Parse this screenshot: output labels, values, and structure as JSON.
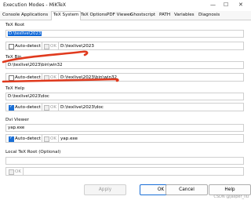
{
  "window": {
    "title": "Execution Modes - MiKTeX"
  },
  "tabs": [
    "Console Applications",
    "TeX System",
    "TeX Options",
    "PDF Viewer",
    "Ghostscript",
    "PATH",
    "Variables",
    "Diagnosis"
  ],
  "active_tab": "TeX System",
  "sections": {
    "tex_root": {
      "label": "TeX Root",
      "path": "D:\\texlive\\2023",
      "auto_detect": "Auto-detect",
      "ok": "OK",
      "detected": "D:\\texlive\\2023"
    },
    "tex_bin": {
      "label": "TeX Bin",
      "path": "D:\\texlive\\2023\\bin\\win32",
      "auto_detect": "Auto-detect",
      "ok": "OK",
      "detected": "D:\\texlive\\2023\\bin\\win32"
    },
    "tex_help": {
      "label": "TeX Help",
      "path": "D:\\texlive\\2023\\doc",
      "auto_detect": "Auto-detect",
      "ok": "OK",
      "detected": "D:\\texlive\\2023\\doc"
    },
    "dvi_viewer": {
      "label": "Dvi Viewer",
      "path": "yap.exe",
      "auto_detect": "Auto-detect",
      "ok": "OK",
      "detected": "yap.exe"
    },
    "local_tex_root": {
      "label": "Local TeX Root (Optional)",
      "path": "",
      "ok": "OK"
    }
  },
  "buttons": {
    "apply": "Apply",
    "ok": "OK",
    "cancel": "Cancel",
    "help": "Help"
  },
  "watermark": "CSDN @jasper_liu",
  "colors": {
    "accent": "#1a6fd6",
    "annotation": "#e03a1e"
  }
}
